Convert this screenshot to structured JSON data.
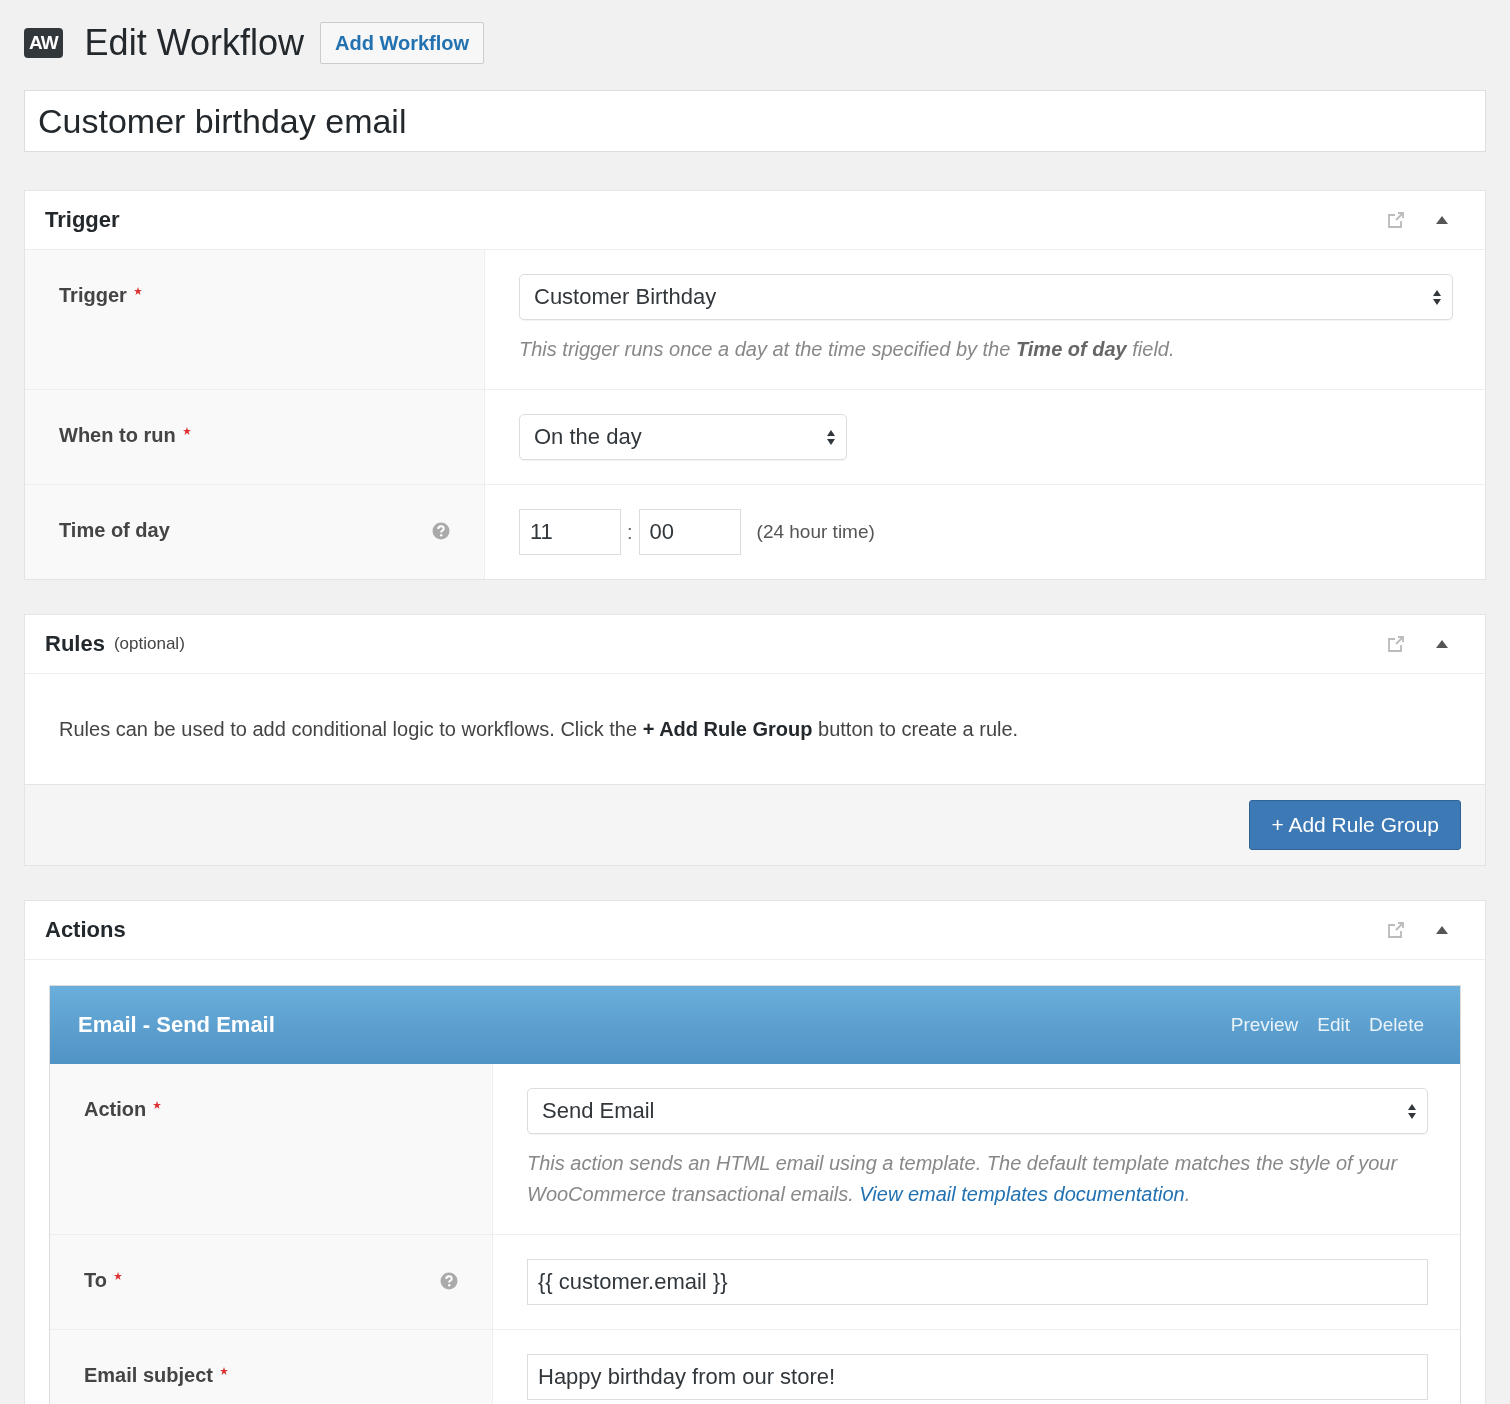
{
  "header": {
    "logo": "AW",
    "title": "Edit Workflow",
    "add_button": "Add Workflow"
  },
  "workflow_name": {
    "value": "Customer birthday email"
  },
  "panels": [
    {
      "kind": "fields",
      "title": "Trigger",
      "fields": [
        {
          "kind": "select",
          "label": "Trigger",
          "required": true,
          "help": false,
          "value": "Customer Birthday",
          "description": "This trigger runs once a day at the time specified by the **Time of day** field."
        },
        {
          "kind": "short_select",
          "label": "When to run",
          "required": true,
          "help": false,
          "value": "On the day"
        },
        {
          "kind": "time",
          "label": "Time of day",
          "required": false,
          "help": true,
          "hours": "11",
          "separator": ":",
          "minutes": "00",
          "note": "(24 hour time)"
        }
      ]
    },
    {
      "kind": "note",
      "title": "Rules",
      "subtitle": "(optional)",
      "body": "Rules can be used to add conditional logic to workflows. Click the **+ Add Rule Group** button to create a rule.",
      "button": "+ Add Rule Group"
    },
    {
      "kind": "actions",
      "title": "Actions",
      "actions": [
        {
          "title": "Email - Send Email",
          "links": [
            "Preview",
            "Edit",
            "Delete"
          ],
          "fields": [
            {
              "kind": "select",
              "label": "Action",
              "required": true,
              "help": false,
              "value": "Send Email",
              "description": "This action sends an HTML email using a template. The default template matches the style of your WooCommerce transactional emails. ",
              "link": "View email templates documentation",
              "description_end": "."
            },
            {
              "kind": "text",
              "label": "To",
              "required": true,
              "help": true,
              "value": "{{ customer.email }}"
            },
            {
              "kind": "text",
              "label": "Email subject",
              "required": true,
              "help": false,
              "value": "Happy birthday from our store!"
            }
          ]
        }
      ]
    }
  ]
}
